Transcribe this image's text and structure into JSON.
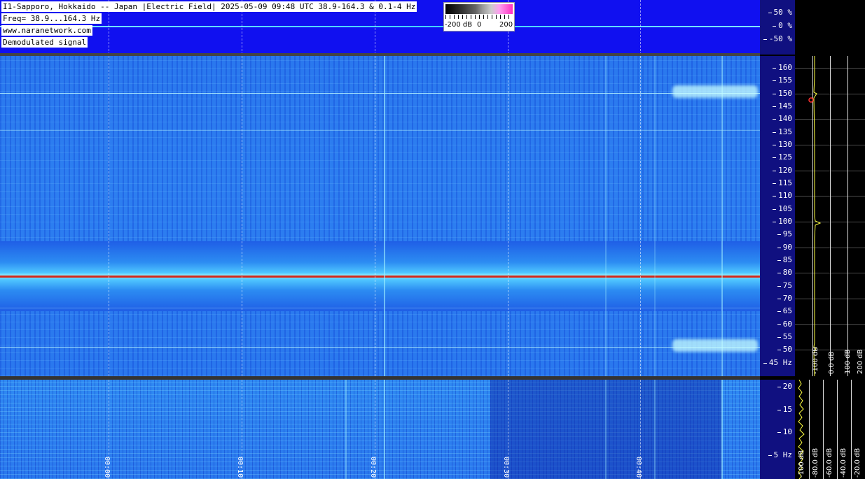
{
  "header": {
    "station_line": "I1-Sapporo, Hokkaido -- Japan |Electric Field| 2025-05-09 09:48 UTC 38.9-164.3 & 0.1-4 Hz",
    "freq_line": "Freq= 38.9...164.3 Hz",
    "website": "www.naranetwork.com",
    "signal_type": "Demodulated signal"
  },
  "color_scale": {
    "min_label": "-200 dB",
    "mid_label": "0",
    "max_label": "200"
  },
  "top_axis": {
    "ticks": [
      "50 %",
      "0 %",
      "-50 %"
    ]
  },
  "main_axis": {
    "ticks": [
      "160",
      "155",
      "150",
      "145",
      "140",
      "135",
      "130",
      "125",
      "120",
      "115",
      "110",
      "105",
      "100",
      "95",
      "90",
      "85",
      "80",
      "75",
      "70",
      "65",
      "60",
      "55",
      "50",
      "45 Hz"
    ]
  },
  "low_axis": {
    "ticks": [
      "20",
      "15",
      "10",
      "5 Hz"
    ]
  },
  "time_labels": [
    "00:00",
    "00:10",
    "00:20",
    "00:30",
    "00:40"
  ],
  "main_spectrum_labels": [
    "-100 dB",
    "0.0 dB",
    "100 dB",
    "200 dB"
  ],
  "low_spectrum_labels": [
    "-100 dB",
    "-80.0 dB",
    "-60.0 dB",
    "-40.0 dB",
    "-20.0 dB"
  ],
  "colors": {
    "background": "#2a78ee",
    "strip": "#1010f0",
    "carrier": "#d4281a",
    "axis_panel": "#101080"
  }
}
